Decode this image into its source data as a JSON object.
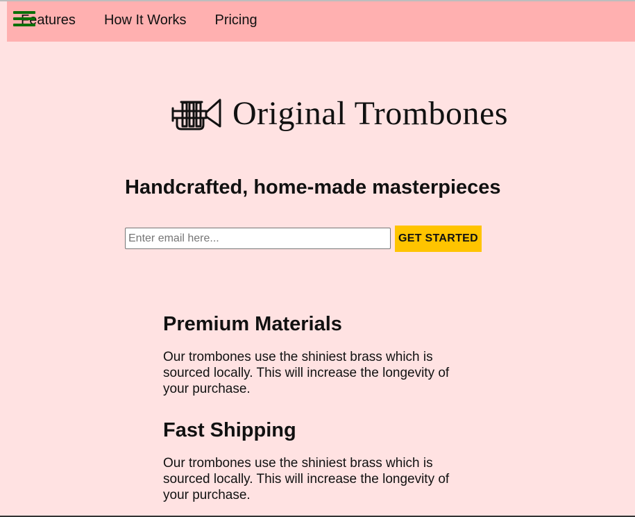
{
  "nav": {
    "links": [
      {
        "label": "Features"
      },
      {
        "label": "How It Works"
      },
      {
        "label": "Pricing"
      }
    ],
    "menu_icon": "hamburger-menu-icon"
  },
  "colors": {
    "page_background": "#ffe2e2",
    "navbar_background": "#ffb0b0",
    "menu_icon": "#086f08",
    "cta_background": "#ffc400"
  },
  "logo": {
    "icon": "trumpet-icon",
    "text": "Original Trombones"
  },
  "hero": {
    "title": "Handcrafted, home-made masterpieces",
    "email_placeholder": "Enter email here...",
    "email_value": "",
    "cta_label": "GET STARTED"
  },
  "features": [
    {
      "title": "Premium Materials",
      "description": "Our trombones use the shiniest brass which is sourced locally. This will increase the longevity of your purchase."
    },
    {
      "title": "Fast Shipping",
      "description": "Our trombones use the shiniest brass which is sourced locally. This will increase the longevity of your purchase."
    }
  ]
}
